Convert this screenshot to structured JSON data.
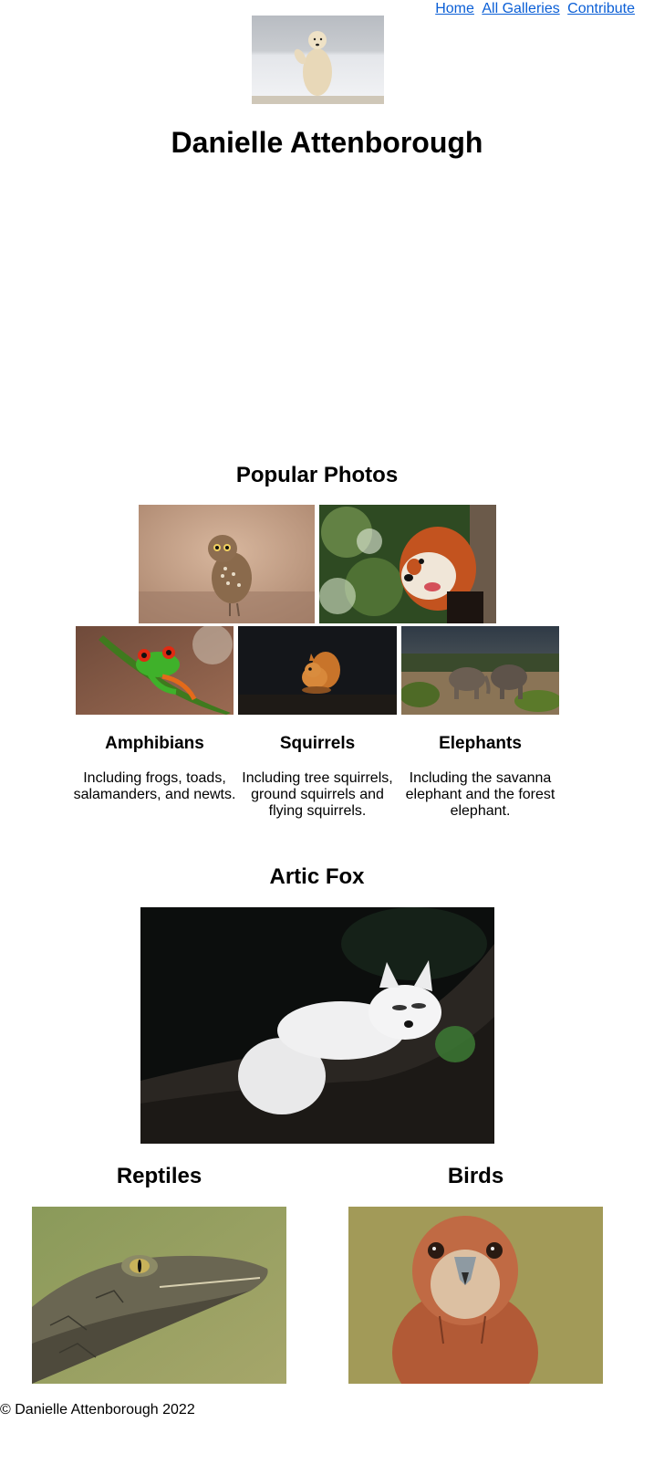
{
  "nav": {
    "links": [
      "Home",
      "All Galleries",
      "Contribute"
    ]
  },
  "header": {
    "title": "Danielle Attenborough",
    "logo_icon": "polar-bear-photo"
  },
  "popular": {
    "heading": "Popular Photos",
    "top_photos": [
      "owl-photo",
      "red-panda-photo"
    ],
    "categories": [
      {
        "title": "Amphibians",
        "description": "Including frogs, toads, salamanders, and newts.",
        "photo": "frog-photo"
      },
      {
        "title": "Squirrels",
        "description": "Including tree squirrels, ground squirrels and flying squirrels.",
        "photo": "squirrel-photo"
      },
      {
        "title": "Elephants",
        "description": "Including the savanna elephant and the forest elephant.",
        "photo": "elephants-photo"
      }
    ]
  },
  "feature": {
    "title": "Artic Fox",
    "photo": "arctic-fox-photo"
  },
  "bottom": [
    {
      "title": "Reptiles",
      "photo": "caiman-photo"
    },
    {
      "title": "Birds",
      "photo": "hawk-photo"
    }
  ],
  "footer": {
    "text": "© Danielle Attenborough 2022"
  },
  "colors": {
    "link": "#0b5fd6",
    "text": "#000000",
    "background": "#ffffff"
  }
}
